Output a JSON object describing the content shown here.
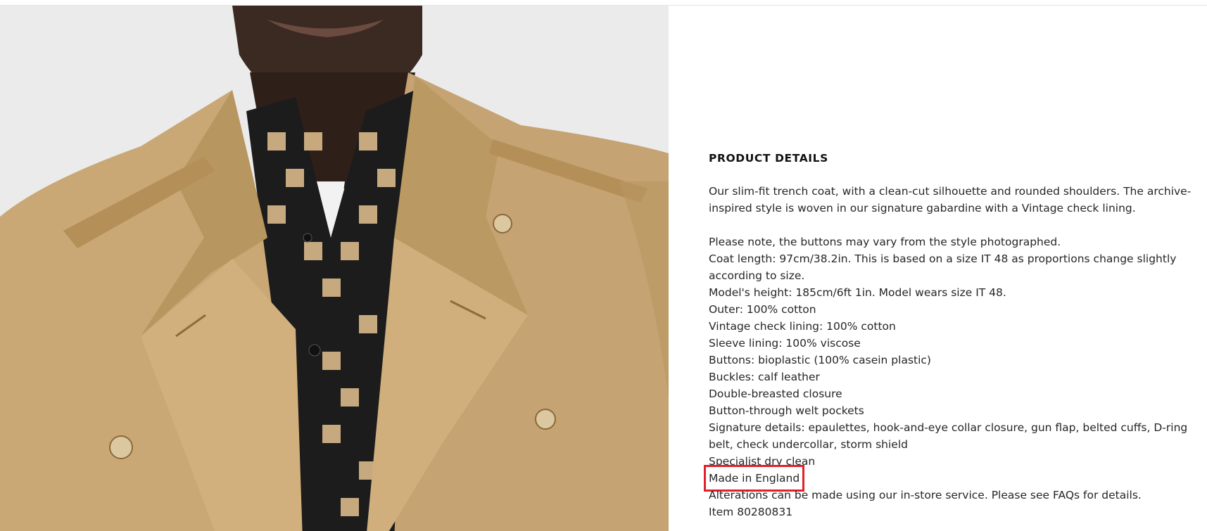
{
  "product_image": {
    "description_icon": "trench-coat-model-photo"
  },
  "details": {
    "heading": "PRODUCT DETAILS",
    "description": "Our slim-fit trench coat, with a clean-cut silhouette and rounded shoulders. The archive-inspired style is woven in our signature gabardine with a Vintage check lining.",
    "lines": [
      "Please note, the buttons may vary from the style photographed.",
      "Coat length: 97cm/38.2in. This is based on a size IT 48 as proportions change slightly according to size.",
      "Model's height: 185cm/6ft 1in. Model wears size IT 48.",
      "Outer: 100% cotton",
      "Vintage check lining: 100% cotton",
      "Sleeve lining: 100% viscose",
      "Buttons: bioplastic (100% casein plastic)",
      "Buckles: calf leather",
      "Double-breasted closure",
      "Button-through welt pockets",
      "Signature details: epaulettes, hook-and-eye collar closure, gun flap, belted cuffs, D-ring belt, check undercollar, storm shield",
      "Specialist dry clean",
      "Made in England",
      "Alterations can be made using our in-store service. Please see FAQs for details.",
      "Item 80280831"
    ]
  },
  "colors": {
    "highlight_box": "#e0202a",
    "coat": "#c9a876",
    "background_photo": "#ebebeb"
  }
}
